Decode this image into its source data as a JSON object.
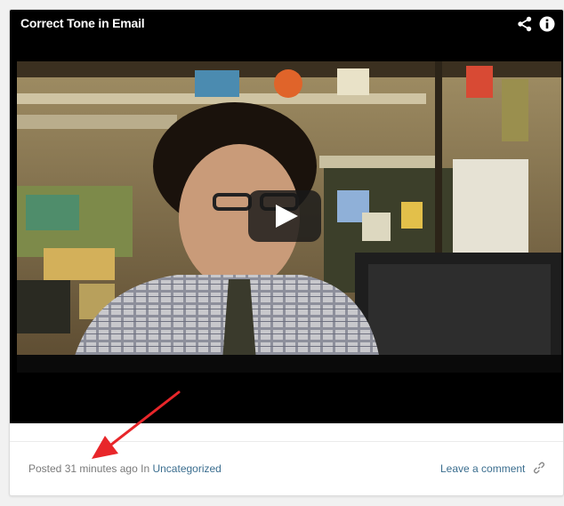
{
  "video": {
    "title": "Correct Tone in Email",
    "icons": {
      "share": "share-icon",
      "info": "info-icon",
      "play": "play-icon"
    }
  },
  "footer": {
    "posted_prefix": "Posted",
    "time_ago": "31 minutes ago",
    "in_word": "In",
    "category": "Uncategorized",
    "comment_link": "Leave a comment",
    "permalink_icon": "link-icon"
  },
  "colors": {
    "link": "#3b6e8f",
    "meta_text": "#7a7a7a",
    "annotation_arrow": "#e8262a"
  }
}
